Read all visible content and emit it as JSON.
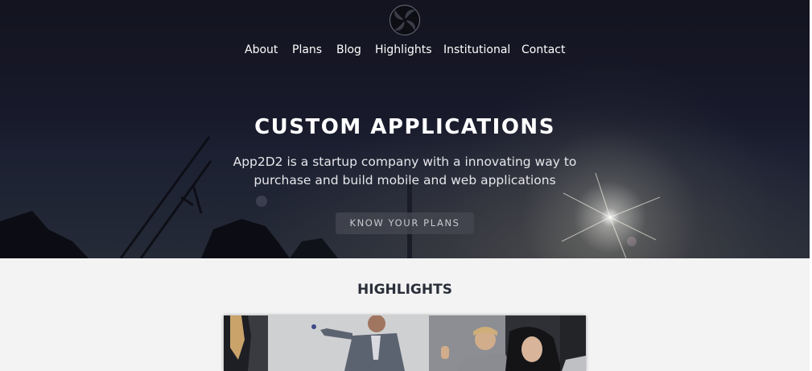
{
  "nav": {
    "items": [
      {
        "label": "About"
      },
      {
        "label": "Plans"
      },
      {
        "label": "Blog"
      },
      {
        "label": "Highlights"
      },
      {
        "label": "Institutional"
      },
      {
        "label": "Contact"
      }
    ]
  },
  "hero": {
    "title": "CUSTOM APPLICATIONS",
    "subtitle_line1": "App2D2 is a startup company with a innovating way to",
    "subtitle_line2": "purchase and build mobile and web applications",
    "cta_label": "KNOW YOUR PLANS"
  },
  "highlights": {
    "title": "HIGHLIGHTS"
  },
  "icons": {
    "logo": "swirl-logo-icon"
  },
  "colors": {
    "hero_bg": "#171829",
    "section_bg": "#f3f3f3",
    "heading": "#2b2f3a",
    "cta_bg": "#46485a"
  }
}
